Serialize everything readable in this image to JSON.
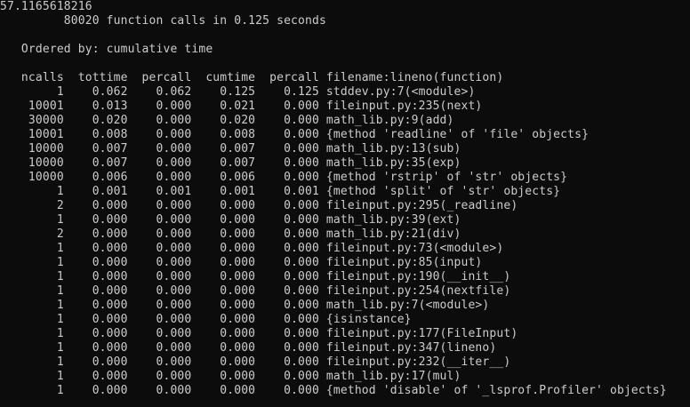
{
  "terminal": {
    "result_line": "57.1165618216",
    "summary_line": "         80020 function calls in 0.125 seconds",
    "ordered_by_line": "   Ordered by: cumulative time",
    "header_line": "   ncalls  tottime  percall  cumtime  percall filename:lineno(function)",
    "rows": [
      "        1    0.062    0.062    0.125    0.125 stddev.py:7(<module>)",
      "    10001    0.013    0.000    0.021    0.000 fileinput.py:235(next)",
      "    30000    0.020    0.000    0.020    0.000 math_lib.py:9(add)",
      "    10001    0.008    0.000    0.008    0.000 {method 'readline' of 'file' objects}",
      "    10000    0.007    0.000    0.007    0.000 math_lib.py:13(sub)",
      "    10000    0.007    0.000    0.007    0.000 math_lib.py:35(exp)",
      "    10000    0.006    0.000    0.006    0.000 {method 'rstrip' of 'str' objects}",
      "        1    0.001    0.001    0.001    0.001 {method 'split' of 'str' objects}",
      "        2    0.000    0.000    0.000    0.000 fileinput.py:295(_readline)",
      "        1    0.000    0.000    0.000    0.000 math_lib.py:39(ext)",
      "        2    0.000    0.000    0.000    0.000 math_lib.py:21(div)",
      "        1    0.000    0.000    0.000    0.000 fileinput.py:73(<module>)",
      "        1    0.000    0.000    0.000    0.000 fileinput.py:85(input)",
      "        1    0.000    0.000    0.000    0.000 fileinput.py:190(__init__)",
      "        1    0.000    0.000    0.000    0.000 fileinput.py:254(nextfile)",
      "        1    0.000    0.000    0.000    0.000 math_lib.py:7(<module>)",
      "        1    0.000    0.000    0.000    0.000 {isinstance}",
      "        1    0.000    0.000    0.000    0.000 fileinput.py:177(FileInput)",
      "        1    0.000    0.000    0.000    0.000 fileinput.py:347(lineno)",
      "        1    0.000    0.000    0.000    0.000 fileinput.py:232(__iter__)",
      "        1    0.000    0.000    0.000    0.000 math_lib.py:17(mul)",
      "        1    0.000    0.000    0.000    0.000 {method 'disable' of '_lsprof.Profiler' objects}"
    ],
    "colors": {
      "background": "#0c0c0c",
      "text": "#cccccc"
    }
  }
}
